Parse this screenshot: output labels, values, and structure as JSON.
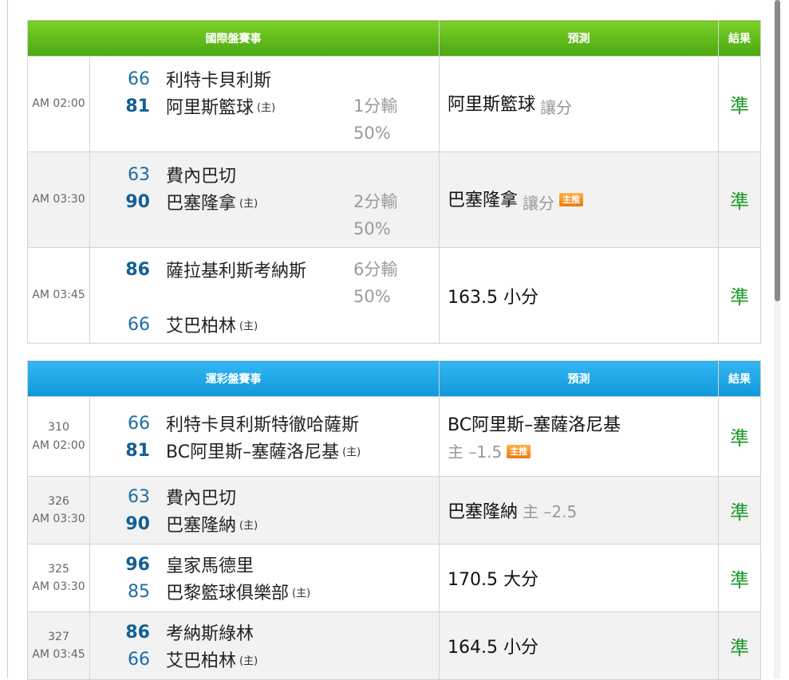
{
  "intl": {
    "headers": {
      "event": "國際盤賽事",
      "prediction": "預測",
      "result": "結果"
    },
    "rows": [
      {
        "time": "AM 02:00",
        "away": {
          "score": "66",
          "name": "利特卡貝利斯"
        },
        "home": {
          "score": "81",
          "name": "阿里斯籃球",
          "tag": "(主)"
        },
        "handicap": "1分輸",
        "pct": "50%",
        "pred_main": "阿里斯籃球",
        "pred_sub": "讓分",
        "badge": "",
        "result": "準"
      },
      {
        "time": "AM 03:30",
        "away": {
          "score": "63",
          "name": "費內巴切"
        },
        "home": {
          "score": "90",
          "name": "巴塞隆拿",
          "tag": "(主)"
        },
        "handicap": "2分輸",
        "pct": "50%",
        "pred_main": "巴塞隆拿",
        "pred_sub": "讓分",
        "badge": "主推",
        "result": "準"
      },
      {
        "time": "AM 03:45",
        "away": {
          "score": "86",
          "name": "薩拉基利斯考納斯"
        },
        "home": {
          "score": "66",
          "name": "艾巴柏林",
          "tag": "(主)"
        },
        "handicap": "6分輸",
        "pct": "50%",
        "pred_main": "163.5 小分",
        "pred_sub": "",
        "badge": "",
        "result": "準"
      }
    ]
  },
  "lottery": {
    "headers": {
      "event": "運彩盤賽事",
      "prediction": "預測",
      "result": "結果"
    },
    "rows": [
      {
        "num": "310",
        "time": "AM 02:00",
        "away": {
          "score": "66",
          "name": "利特卡貝利斯特徹哈薩斯"
        },
        "home": {
          "score": "81",
          "name": "BC阿里斯–塞薩洛尼基",
          "tag": "(主)"
        },
        "pred_main": "BC阿里斯–塞薩洛尼基",
        "pred_sub": "主 –1.5",
        "badge": "主推",
        "result": "準"
      },
      {
        "num": "326",
        "time": "AM 03:30",
        "away": {
          "score": "63",
          "name": "費內巴切"
        },
        "home": {
          "score": "90",
          "name": "巴塞隆納",
          "tag": "(主)"
        },
        "pred_main": "巴塞隆納",
        "pred_sub": "主 –2.5",
        "badge": "",
        "result": "準"
      },
      {
        "num": "325",
        "time": "AM 03:30",
        "away": {
          "score": "96",
          "name": "皇家馬德里"
        },
        "home": {
          "score": "85",
          "name": "巴黎籃球俱樂部",
          "tag": "(主)"
        },
        "pred_main": "170.5 大分",
        "pred_sub": "",
        "badge": "",
        "result": "準"
      },
      {
        "num": "327",
        "time": "AM 03:45",
        "away": {
          "score": "86",
          "name": "考納斯綠林"
        },
        "home": {
          "score": "66",
          "name": "艾巴柏林",
          "tag": "(主)"
        },
        "pred_main": "164.5 小分",
        "pred_sub": "",
        "badge": "",
        "result": "準"
      }
    ]
  }
}
